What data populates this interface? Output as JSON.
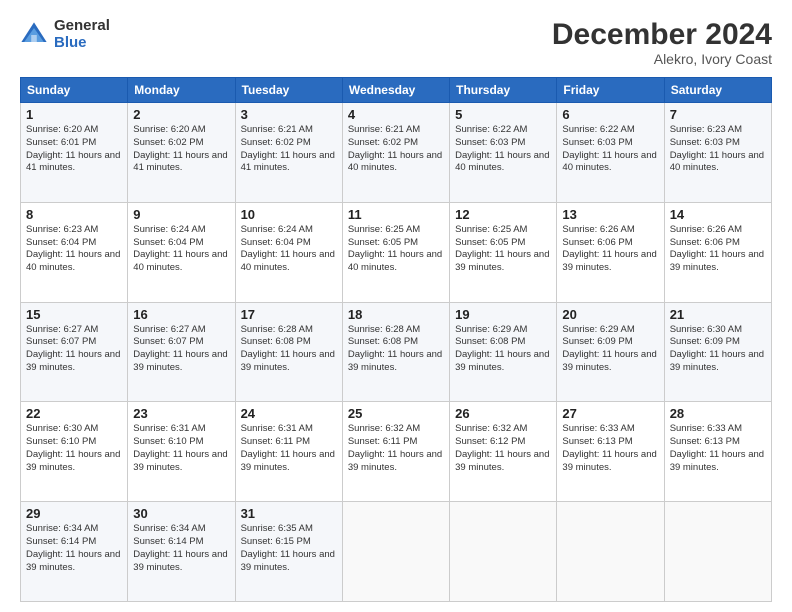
{
  "logo": {
    "general": "General",
    "blue": "Blue"
  },
  "header": {
    "month": "December 2024",
    "location": "Alekro, Ivory Coast"
  },
  "weekdays": [
    "Sunday",
    "Monday",
    "Tuesday",
    "Wednesday",
    "Thursday",
    "Friday",
    "Saturday"
  ],
  "weeks": [
    [
      {
        "day": "1",
        "sunrise": "6:20 AM",
        "sunset": "6:01 PM",
        "daylight": "11 hours and 41 minutes."
      },
      {
        "day": "2",
        "sunrise": "6:20 AM",
        "sunset": "6:02 PM",
        "daylight": "11 hours and 41 minutes."
      },
      {
        "day": "3",
        "sunrise": "6:21 AM",
        "sunset": "6:02 PM",
        "daylight": "11 hours and 41 minutes."
      },
      {
        "day": "4",
        "sunrise": "6:21 AM",
        "sunset": "6:02 PM",
        "daylight": "11 hours and 40 minutes."
      },
      {
        "day": "5",
        "sunrise": "6:22 AM",
        "sunset": "6:03 PM",
        "daylight": "11 hours and 40 minutes."
      },
      {
        "day": "6",
        "sunrise": "6:22 AM",
        "sunset": "6:03 PM",
        "daylight": "11 hours and 40 minutes."
      },
      {
        "day": "7",
        "sunrise": "6:23 AM",
        "sunset": "6:03 PM",
        "daylight": "11 hours and 40 minutes."
      }
    ],
    [
      {
        "day": "8",
        "sunrise": "6:23 AM",
        "sunset": "6:04 PM",
        "daylight": "11 hours and 40 minutes."
      },
      {
        "day": "9",
        "sunrise": "6:24 AM",
        "sunset": "6:04 PM",
        "daylight": "11 hours and 40 minutes."
      },
      {
        "day": "10",
        "sunrise": "6:24 AM",
        "sunset": "6:04 PM",
        "daylight": "11 hours and 40 minutes."
      },
      {
        "day": "11",
        "sunrise": "6:25 AM",
        "sunset": "6:05 PM",
        "daylight": "11 hours and 40 minutes."
      },
      {
        "day": "12",
        "sunrise": "6:25 AM",
        "sunset": "6:05 PM",
        "daylight": "11 hours and 39 minutes."
      },
      {
        "day": "13",
        "sunrise": "6:26 AM",
        "sunset": "6:06 PM",
        "daylight": "11 hours and 39 minutes."
      },
      {
        "day": "14",
        "sunrise": "6:26 AM",
        "sunset": "6:06 PM",
        "daylight": "11 hours and 39 minutes."
      }
    ],
    [
      {
        "day": "15",
        "sunrise": "6:27 AM",
        "sunset": "6:07 PM",
        "daylight": "11 hours and 39 minutes."
      },
      {
        "day": "16",
        "sunrise": "6:27 AM",
        "sunset": "6:07 PM",
        "daylight": "11 hours and 39 minutes."
      },
      {
        "day": "17",
        "sunrise": "6:28 AM",
        "sunset": "6:08 PM",
        "daylight": "11 hours and 39 minutes."
      },
      {
        "day": "18",
        "sunrise": "6:28 AM",
        "sunset": "6:08 PM",
        "daylight": "11 hours and 39 minutes."
      },
      {
        "day": "19",
        "sunrise": "6:29 AM",
        "sunset": "6:08 PM",
        "daylight": "11 hours and 39 minutes."
      },
      {
        "day": "20",
        "sunrise": "6:29 AM",
        "sunset": "6:09 PM",
        "daylight": "11 hours and 39 minutes."
      },
      {
        "day": "21",
        "sunrise": "6:30 AM",
        "sunset": "6:09 PM",
        "daylight": "11 hours and 39 minutes."
      }
    ],
    [
      {
        "day": "22",
        "sunrise": "6:30 AM",
        "sunset": "6:10 PM",
        "daylight": "11 hours and 39 minutes."
      },
      {
        "day": "23",
        "sunrise": "6:31 AM",
        "sunset": "6:10 PM",
        "daylight": "11 hours and 39 minutes."
      },
      {
        "day": "24",
        "sunrise": "6:31 AM",
        "sunset": "6:11 PM",
        "daylight": "11 hours and 39 minutes."
      },
      {
        "day": "25",
        "sunrise": "6:32 AM",
        "sunset": "6:11 PM",
        "daylight": "11 hours and 39 minutes."
      },
      {
        "day": "26",
        "sunrise": "6:32 AM",
        "sunset": "6:12 PM",
        "daylight": "11 hours and 39 minutes."
      },
      {
        "day": "27",
        "sunrise": "6:33 AM",
        "sunset": "6:13 PM",
        "daylight": "11 hours and 39 minutes."
      },
      {
        "day": "28",
        "sunrise": "6:33 AM",
        "sunset": "6:13 PM",
        "daylight": "11 hours and 39 minutes."
      }
    ],
    [
      {
        "day": "29",
        "sunrise": "6:34 AM",
        "sunset": "6:14 PM",
        "daylight": "11 hours and 39 minutes."
      },
      {
        "day": "30",
        "sunrise": "6:34 AM",
        "sunset": "6:14 PM",
        "daylight": "11 hours and 39 minutes."
      },
      {
        "day": "31",
        "sunrise": "6:35 AM",
        "sunset": "6:15 PM",
        "daylight": "11 hours and 39 minutes."
      },
      null,
      null,
      null,
      null
    ]
  ]
}
